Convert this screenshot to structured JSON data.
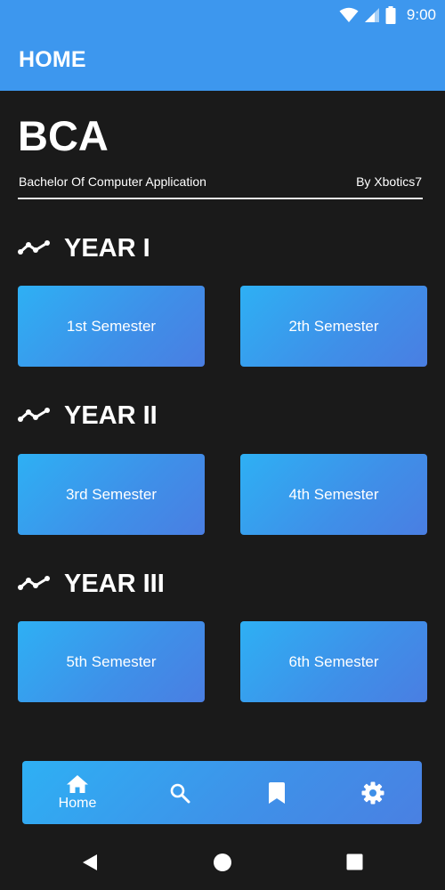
{
  "status_bar": {
    "time": "9:00",
    "icons": [
      "wifi-icon",
      "cell-signal-icon",
      "battery-icon"
    ]
  },
  "app_bar": {
    "title": "HOME"
  },
  "header": {
    "title": "BCA",
    "subtitle": "Bachelor Of Computer Application",
    "author": "By Xbotics7"
  },
  "years": [
    {
      "label": "YEAR I",
      "icon": "trending-line-icon",
      "semesters": [
        "1st Semester",
        "2th Semester"
      ]
    },
    {
      "label": "YEAR II",
      "icon": "trending-line-icon",
      "semesters": [
        "3rd Semester",
        "4th Semester"
      ]
    },
    {
      "label": "YEAR III",
      "icon": "trending-line-icon",
      "semesters": [
        "5th Semester",
        "6th Semester"
      ]
    }
  ],
  "bottom_nav": {
    "items": [
      {
        "icon": "home-icon",
        "label": "Home",
        "active": true
      },
      {
        "icon": "search-icon",
        "label": ""
      },
      {
        "icon": "bookmark-icon",
        "label": ""
      },
      {
        "icon": "gear-icon",
        "label": ""
      }
    ]
  },
  "system_nav": [
    "back-icon",
    "home-circle-icon",
    "recents-icon"
  ],
  "colors": {
    "primary": "#3d97ee",
    "background": "#1a1a1a",
    "gradient_start": "#2eb0f4",
    "gradient_end": "#4a7ee2"
  }
}
